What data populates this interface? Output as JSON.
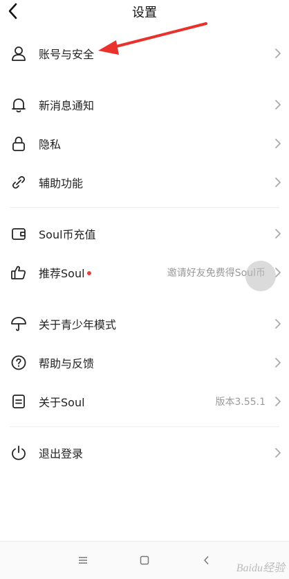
{
  "header": {
    "title": "设置"
  },
  "menu": {
    "account": {
      "label": "账号与安全"
    },
    "notifications": {
      "label": "新消息通知"
    },
    "privacy": {
      "label": "隐私"
    },
    "accessibility": {
      "label": "辅助功能"
    },
    "coins": {
      "label": "Soul币充值"
    },
    "recommend": {
      "label": "推荐Soul",
      "value": "邀请好友免费得Soul币"
    },
    "teen_mode": {
      "label": "关于青少年模式"
    },
    "help": {
      "label": "帮助与反馈"
    },
    "about": {
      "label": "关于Soul",
      "value": "版本3.55.1"
    },
    "logout": {
      "label": "退出登录"
    }
  },
  "colors": {
    "annotation_arrow": "#e8322d",
    "badge_dot": "#e8423f"
  },
  "watermark": {
    "text": "Baidu经验"
  }
}
